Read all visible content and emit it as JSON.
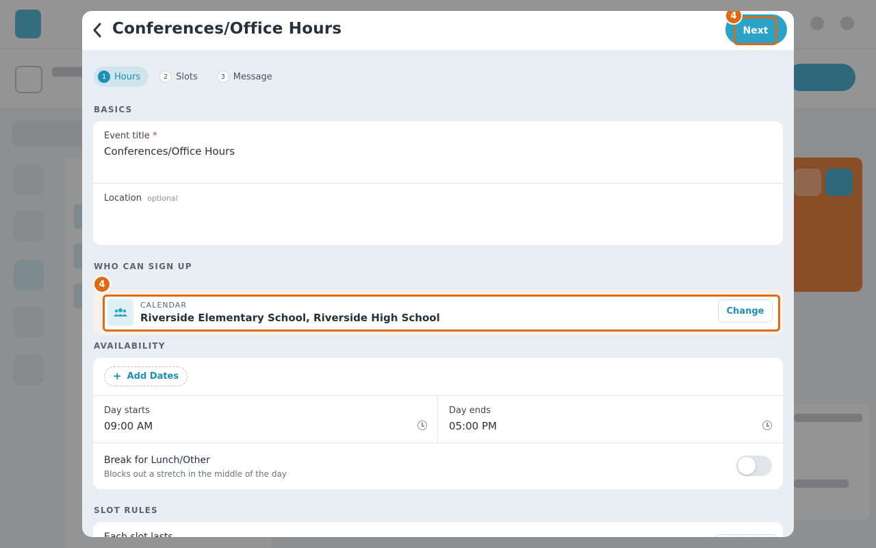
{
  "modal": {
    "title": "Conferences/Office Hours",
    "next_label": "Next",
    "callout_badge": "4"
  },
  "steps": [
    {
      "num": "1",
      "label": "Hours",
      "active": true
    },
    {
      "num": "2",
      "label": "Slots",
      "active": false
    },
    {
      "num": "3",
      "label": "Message",
      "active": false
    }
  ],
  "basics": {
    "section_label": "BASICS",
    "event_title_label": "Event title",
    "required_mark": "*",
    "event_title_value": "Conferences/Office Hours",
    "location_label": "Location",
    "location_optional": "optional",
    "location_value": ""
  },
  "signup": {
    "section_label": "WHO CAN SIGN UP",
    "calendar_kicker": "CALENDAR",
    "calendar_value": "Riverside Elementary School, Riverside High School",
    "change_label": "Change",
    "callout_badge": "4"
  },
  "availability": {
    "section_label": "AVAILABILITY",
    "add_dates_label": "Add Dates",
    "day_starts_label": "Day starts",
    "day_starts_value": "09:00 AM",
    "day_ends_label": "Day ends",
    "day_ends_value": "05:00 PM",
    "break_title": "Break for Lunch/Other",
    "break_subtitle": "Blocks out a stretch in the middle of the day",
    "break_enabled": false
  },
  "slot_rules": {
    "section_label": "SLOT RULES",
    "slot_length_label": "Each slot lasts"
  },
  "colors": {
    "accent": "#2ba3c9",
    "callout": "#e06a12"
  }
}
